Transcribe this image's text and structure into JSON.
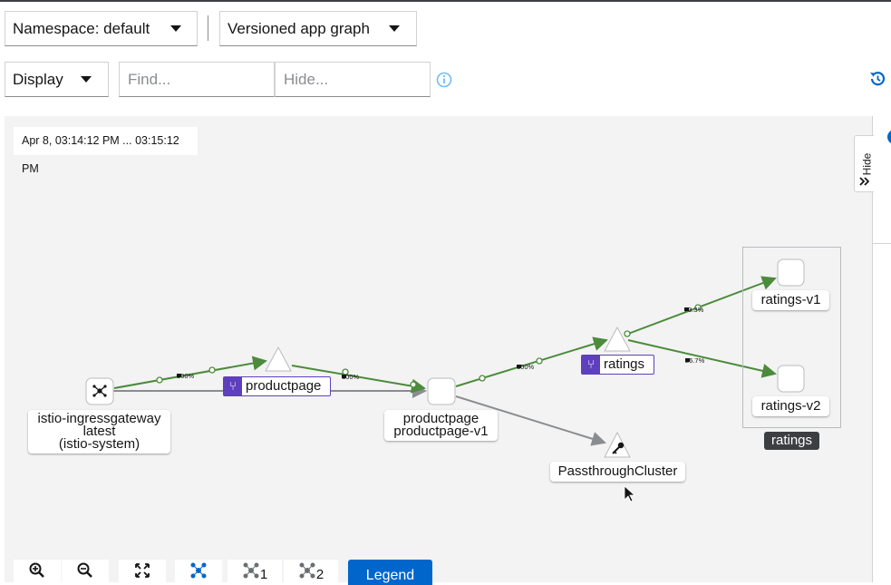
{
  "toolbar": {
    "namespace_label": "Namespace: default",
    "graph_type_label": "Versioned app graph",
    "display_label": "Display",
    "find_placeholder": "Find...",
    "hide_placeholder": "Hide..."
  },
  "graph": {
    "time_range": "Apr 8, 03:14:12 PM ... 03:15:12 PM",
    "hide_tab_label": "Hide",
    "nodes": {
      "gateway_lines": [
        "istio-ingressgateway",
        "latest",
        "(istio-system)"
      ],
      "productpage_svc": "productpage",
      "productpage_wl_lines": [
        "productpage",
        "productpage-v1"
      ],
      "ratings_svc": "ratings",
      "passthrough": "PassthroughCluster",
      "ratings_v1": "ratings-v1",
      "ratings_v2": "ratings-v2",
      "ratings_app": "ratings"
    },
    "edge_labels": {
      "gw_to_pp": "100%",
      "pp_to_wl": "100%",
      "wl_to_ratings": "100%",
      "ratings_to_v1": "73.3%",
      "ratings_to_v2": "26.7%"
    },
    "colors": {
      "edge_green": "#4b8b3b",
      "edge_gray": "#8a8d90",
      "service_badge": "#5e40be",
      "legend": "#0066cc"
    }
  },
  "bottom_toolbar": {
    "zoom_in": "zoom-in-icon",
    "zoom_out": "zoom-out-icon",
    "fit": "expand-icon",
    "layout_default": "topology-icon",
    "layout_1": "1",
    "layout_2": "2",
    "legend_label": "Legend"
  }
}
